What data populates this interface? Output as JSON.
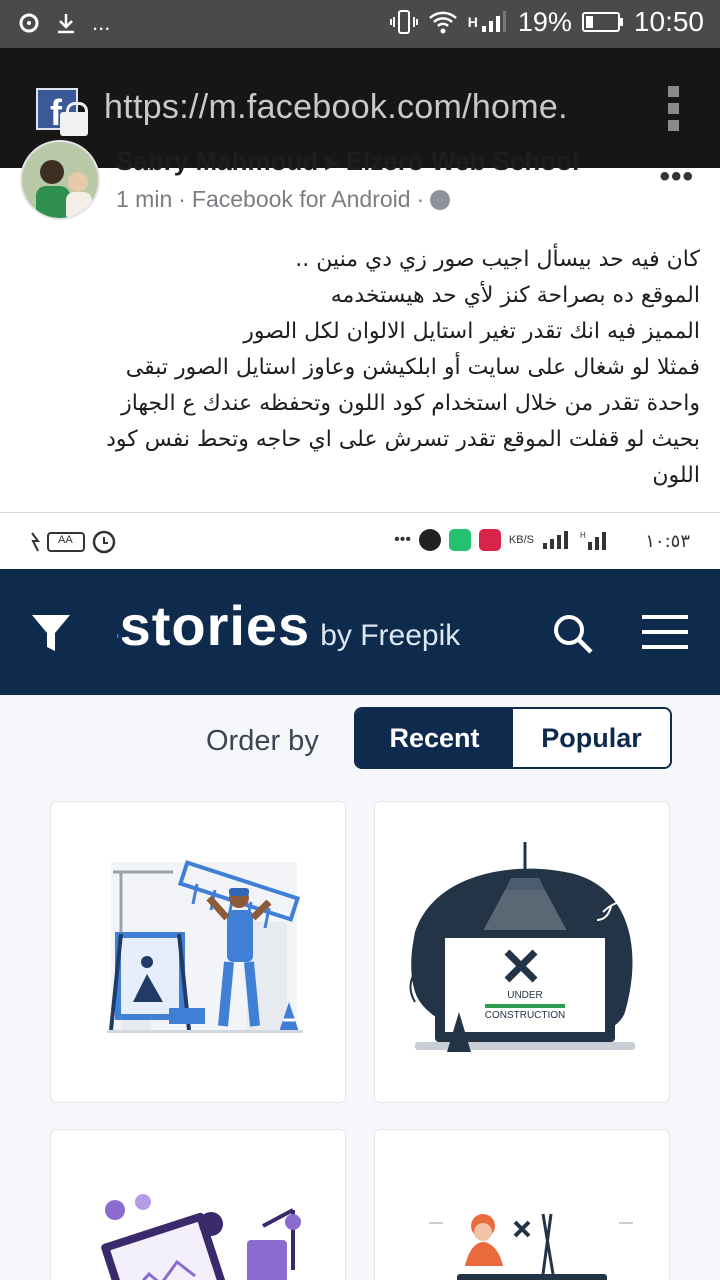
{
  "status_bar": {
    "battery": "19%",
    "time": "10:50",
    "network": "H",
    "overflow": "..."
  },
  "browser": {
    "url": "https://m.facebook.com/home."
  },
  "post": {
    "author": "Sabry Mahmoud ▸ Elzero Web School",
    "time": "1 min",
    "source": "Facebook for Android",
    "sep": "·",
    "more": "•••",
    "lines": [
      "كان فيه حد بيسأل اجيب صور زي دي منين ..",
      "الموقع ده بصراحة كنز لأي حد هيستخدمه",
      "المميز فيه انك تقدر تغير استايل الالوان لكل الصور",
      "فمثلا لو شغال على سايت أو ابلكيشن وعاوز استايل الصور تبقى",
      "واحدة تقدر من خلال استخدام كود اللون وتحفظه عندك ع الجهاز",
      "بحيث لو قفلت الموقع تقدر تسرش على اي حاجه وتحط نفس كود",
      "اللون"
    ]
  },
  "screenshot": {
    "status_left": "AA",
    "status_time": "١٠:٥٣",
    "kbs": "KB/S",
    "logo_text": "stories",
    "logo_by": "by Freepik",
    "order_by_label": "Order by",
    "tabs": [
      "Recent",
      "Popular"
    ],
    "active_tab": "Recent",
    "card2_text_1": "UNDER",
    "card2_text_2": "CONSTRUCTION"
  },
  "colors": {
    "status_bar": "#4a4a4a",
    "browser_bar": "#161616",
    "stories_navy": "#0e2a4d",
    "accent_blue": "#3aa6ff",
    "illustration_blue": "#3f7fd6"
  }
}
